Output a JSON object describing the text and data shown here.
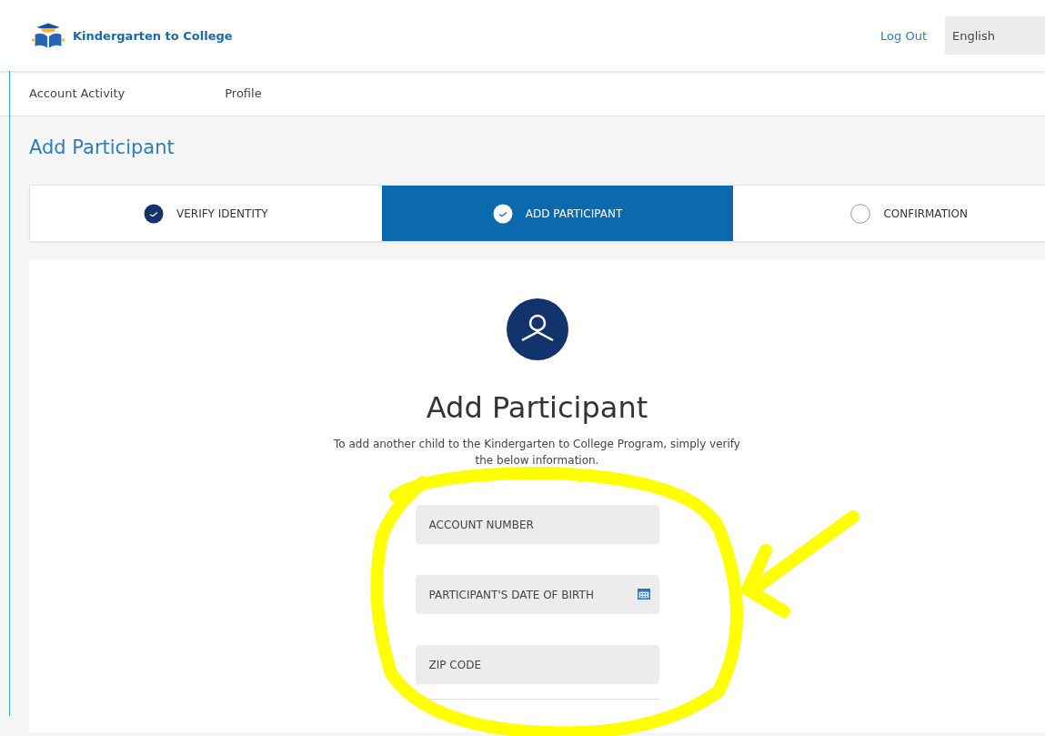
{
  "header": {
    "brand": "Kindergarten to College",
    "logout": "Log Out",
    "language": "English"
  },
  "nav": [
    "Account Activity",
    "Profile"
  ],
  "page_title": "Add Participant",
  "steps": [
    {
      "label": "VERIFY IDENTITY",
      "completed": true,
      "selected": false
    },
    {
      "label": "ADD PARTICIPANT",
      "completed": true,
      "selected": true
    },
    {
      "label": "CONFIRMATION",
      "completed": false,
      "selected": false
    }
  ],
  "form": {
    "heading": "Add Participant",
    "intro": "To add another child to the Kindergarten to College Program, simply verify the below information.",
    "fields": [
      {
        "placeholder": "ACCOUNT NUMBER",
        "kind": "text"
      },
      {
        "placeholder": "PARTICIPANT'S DATE OF BIRTH",
        "kind": "date"
      },
      {
        "placeholder": "ZIP CODE",
        "kind": "text"
      }
    ]
  }
}
